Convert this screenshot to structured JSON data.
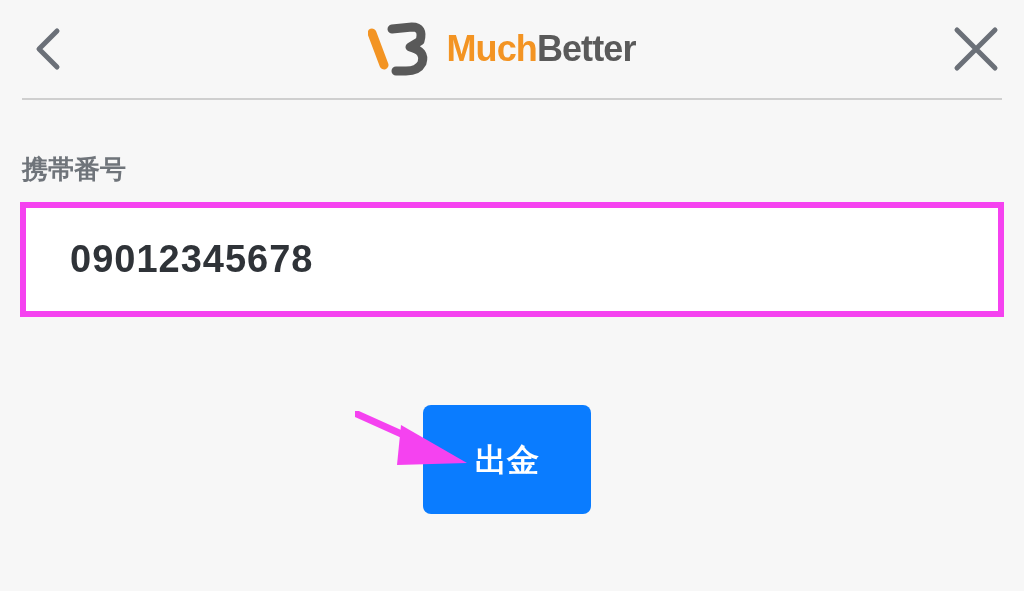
{
  "header": {
    "brand_first": "Much",
    "brand_second": "Better"
  },
  "phone_field": {
    "label": "携帯番号",
    "value": "09012345678",
    "highlighted": true
  },
  "submit_button": {
    "label": "出金",
    "pointer_arrow": true
  }
}
